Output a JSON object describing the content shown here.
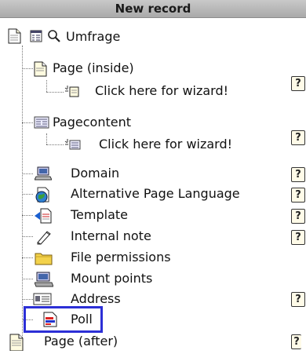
{
  "header": {
    "title": "New record"
  },
  "root": {
    "label": "Umfrage"
  },
  "items": [
    {
      "label": "Page (inside)"
    },
    {
      "label": "Click here for wizard!"
    },
    {
      "label": "Pagecontent"
    },
    {
      "label": "Click here for wizard!"
    },
    {
      "label": "Domain"
    },
    {
      "label": "Alternative Page Language"
    },
    {
      "label": "Template"
    },
    {
      "label": "Internal note"
    },
    {
      "label": "File permissions"
    },
    {
      "label": "Mount points"
    },
    {
      "label": "Address"
    },
    {
      "label": "Poll"
    },
    {
      "label": "Page (after)"
    }
  ],
  "help_glyph": "?",
  "colors": {
    "highlight": "#2c2fd6",
    "header": "#b5b5b5"
  }
}
